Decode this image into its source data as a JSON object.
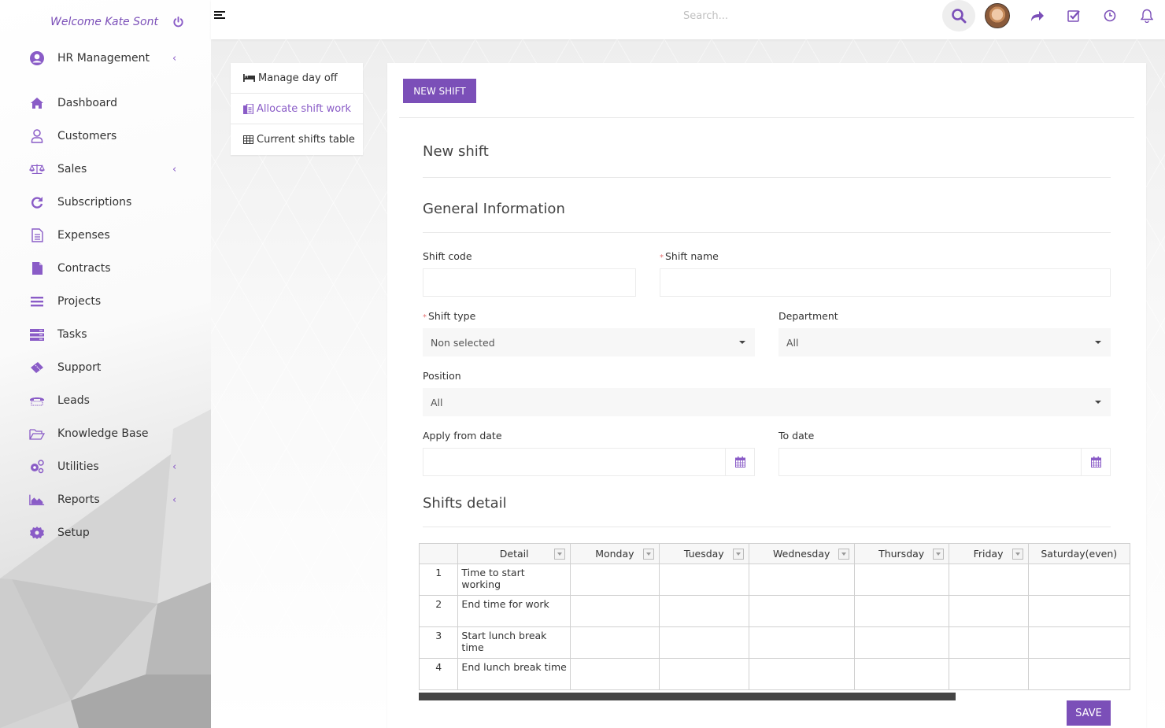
{
  "sidebar": {
    "welcome": "Welcome Kate Sont",
    "items": [
      {
        "label": "HR Management",
        "icon": "user-circle-icon",
        "has_submenu": true
      },
      {
        "label": "Dashboard",
        "icon": "home-icon",
        "has_submenu": false
      },
      {
        "label": "Customers",
        "icon": "user-icon",
        "has_submenu": false
      },
      {
        "label": "Sales",
        "icon": "balance-scale-icon",
        "has_submenu": true
      },
      {
        "label": "Subscriptions",
        "icon": "refresh-icon",
        "has_submenu": false
      },
      {
        "label": "Expenses",
        "icon": "file-text-icon",
        "has_submenu": false
      },
      {
        "label": "Contracts",
        "icon": "file-icon",
        "has_submenu": false
      },
      {
        "label": "Projects",
        "icon": "bars-icon",
        "has_submenu": false
      },
      {
        "label": "Tasks",
        "icon": "tasks-icon",
        "has_submenu": false
      },
      {
        "label": "Support",
        "icon": "ticket-icon",
        "has_submenu": false
      },
      {
        "label": "Leads",
        "icon": "phone-icon",
        "has_submenu": false
      },
      {
        "label": "Knowledge Base",
        "icon": "folder-open-icon",
        "has_submenu": false
      },
      {
        "label": "Utilities",
        "icon": "cogs-icon",
        "has_submenu": true
      },
      {
        "label": "Reports",
        "icon": "area-chart-icon",
        "has_submenu": true
      },
      {
        "label": "Setup",
        "icon": "cog-icon",
        "has_submenu": false
      }
    ]
  },
  "header": {
    "search_placeholder": "Search..."
  },
  "submenu": {
    "items": [
      {
        "label": "Manage day off",
        "icon": "bed-icon",
        "active": false
      },
      {
        "label": "Allocate shift work",
        "icon": "clipboard-icon",
        "active": true
      },
      {
        "label": "Current shifts table",
        "icon": "table-icon",
        "active": false
      }
    ]
  },
  "panel": {
    "new_shift_button": "NEW SHIFT",
    "title": "New shift",
    "general_info_title": "General Information",
    "fields": {
      "shift_code": {
        "label": "Shift code",
        "value": ""
      },
      "shift_name": {
        "label": "Shift name",
        "value": "",
        "required": "*"
      },
      "shift_type": {
        "label": "Shift type",
        "value": "Non selected",
        "required": "*"
      },
      "department": {
        "label": "Department",
        "value": "All"
      },
      "position": {
        "label": "Position",
        "value": "All"
      },
      "apply_from_date": {
        "label": "Apply from date",
        "value": ""
      },
      "to_date": {
        "label": "To date",
        "value": ""
      }
    },
    "shifts_detail_title": "Shifts detail",
    "table": {
      "columns": [
        "",
        "Detail",
        "Monday",
        "Tuesday",
        "Wednesday",
        "Thursday",
        "Friday",
        "Saturday(even)"
      ],
      "rows": [
        {
          "num": "1",
          "detail": "Time to start working"
        },
        {
          "num": "2",
          "detail": "End time for work"
        },
        {
          "num": "3",
          "detail": "Start lunch break time"
        },
        {
          "num": "4",
          "detail": "End lunch break time"
        }
      ]
    },
    "save_button": "SAVE"
  },
  "colors": {
    "accent": "#7b4fb8",
    "icon": "#8a5cc7",
    "required": "#e57373"
  }
}
